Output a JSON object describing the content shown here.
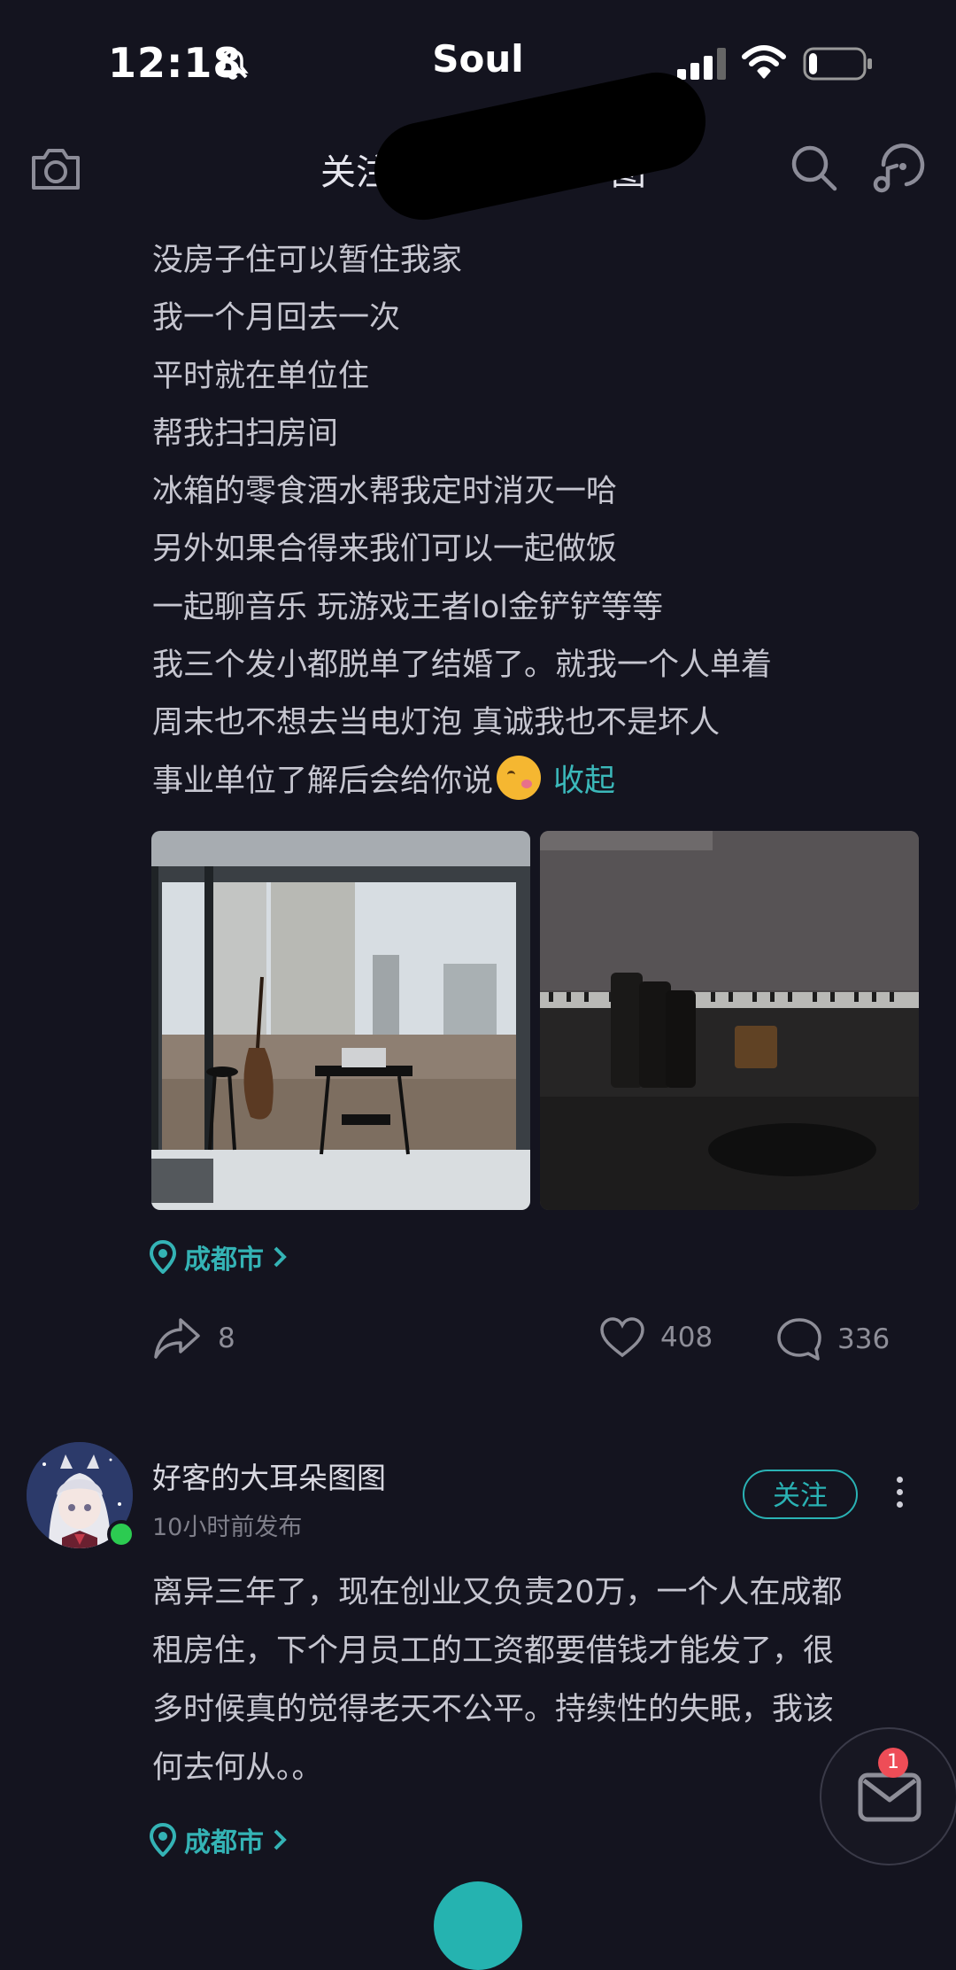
{
  "status_bar": {
    "time": "12:18",
    "carrier": "Soul",
    "battery_level": 0.15
  },
  "top_nav": {
    "tab_follow": "关注",
    "tab_active_fragment": "",
    "tab_other_fragment": "图"
  },
  "post1": {
    "lines": [
      "没房子住可以暂住我家",
      "我一个月回去一次",
      "平时就在单位住",
      "帮我扫扫房间",
      "冰箱的零食酒水帮我定时消灭一哈",
      "另外如果合得来我们可以一起做饭",
      "一起聊音乐 玩游戏王者lol金铲铲等等",
      "我三个发小都脱单了结婚了。就我一个人单着",
      "周末也不想去当电灯泡 真诚我也不是坏人",
      "事业单位了解后会给你说"
    ],
    "emoji": "slightly-smiling-face",
    "collapse_label": "收起",
    "location": "成都市",
    "share_count": "8",
    "like_count": "408",
    "comment_count": "336"
  },
  "post2": {
    "username": "好客的大耳朵图图",
    "time": "10小时前发布",
    "follow_label": "关注",
    "lines": [
      "离异三年了，现在创业又负责20万，一个人在成都",
      "租房住，下个月员工的工资都要借钱才能发了，很",
      "多时候真的觉得老天不公平。持续性的失眠，我该",
      "何去何从。。"
    ],
    "location": "成都市"
  },
  "messages": {
    "badge_count": "1"
  },
  "colors": {
    "background": "#14141f",
    "accent": "#2ab2b4",
    "online": "#2ccb51",
    "badge": "#ee4d57"
  }
}
